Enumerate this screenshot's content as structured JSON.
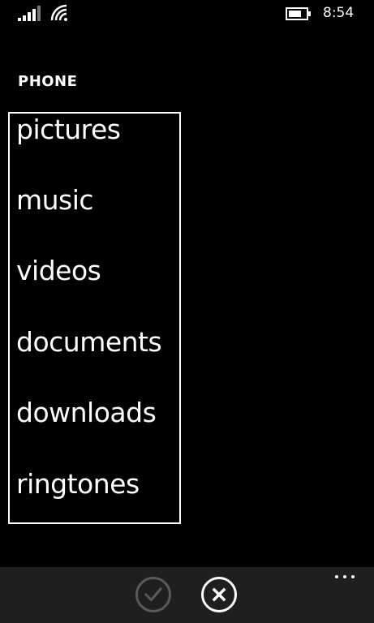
{
  "status_bar": {
    "time": "8:54",
    "signal_icon": "signal-strength-icon",
    "wifi_icon": "wifi-icon",
    "battery_icon": "battery-icon",
    "battery_level": 0.75
  },
  "header": {
    "title": "PHONE"
  },
  "folders": [
    {
      "label": "pictures"
    },
    {
      "label": "music"
    },
    {
      "label": "videos"
    },
    {
      "label": "documents"
    },
    {
      "label": "downloads"
    },
    {
      "label": "ringtones"
    }
  ],
  "app_bar": {
    "accept_icon": "checkmark-icon",
    "accept_enabled": false,
    "cancel_icon": "close-icon",
    "more_icon": "ellipsis-icon"
  },
  "colors": {
    "background": "#000000",
    "app_bar": "#1f1f1f",
    "foreground": "#ffffff",
    "disabled": "#5a5a5a"
  }
}
